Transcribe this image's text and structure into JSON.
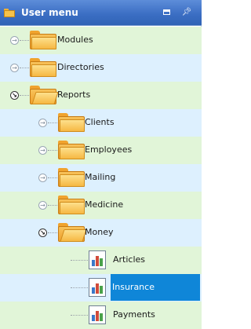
{
  "panel": {
    "title": "User menu"
  },
  "tree": [
    {
      "label": "Modules",
      "kind": "folder",
      "open": false
    },
    {
      "label": "Directories",
      "kind": "folder",
      "open": false
    },
    {
      "label": "Reports",
      "kind": "folder",
      "open": true
    },
    {
      "label": "Clients",
      "kind": "folder",
      "open": false
    },
    {
      "label": "Employees",
      "kind": "folder",
      "open": false
    },
    {
      "label": "Mailing",
      "kind": "folder",
      "open": false
    },
    {
      "label": "Medicine",
      "kind": "folder",
      "open": false
    },
    {
      "label": "Money",
      "kind": "folder",
      "open": true
    },
    {
      "label": "Articles",
      "kind": "report"
    },
    {
      "label": "Insurance",
      "kind": "report",
      "selected": true
    },
    {
      "label": "Payments",
      "kind": "report"
    }
  ],
  "colors": {
    "selection": "#0f86d8",
    "row_alt": "#e1f5d8",
    "row_base": "#ddf0fe",
    "header": "#3c6fc4"
  }
}
